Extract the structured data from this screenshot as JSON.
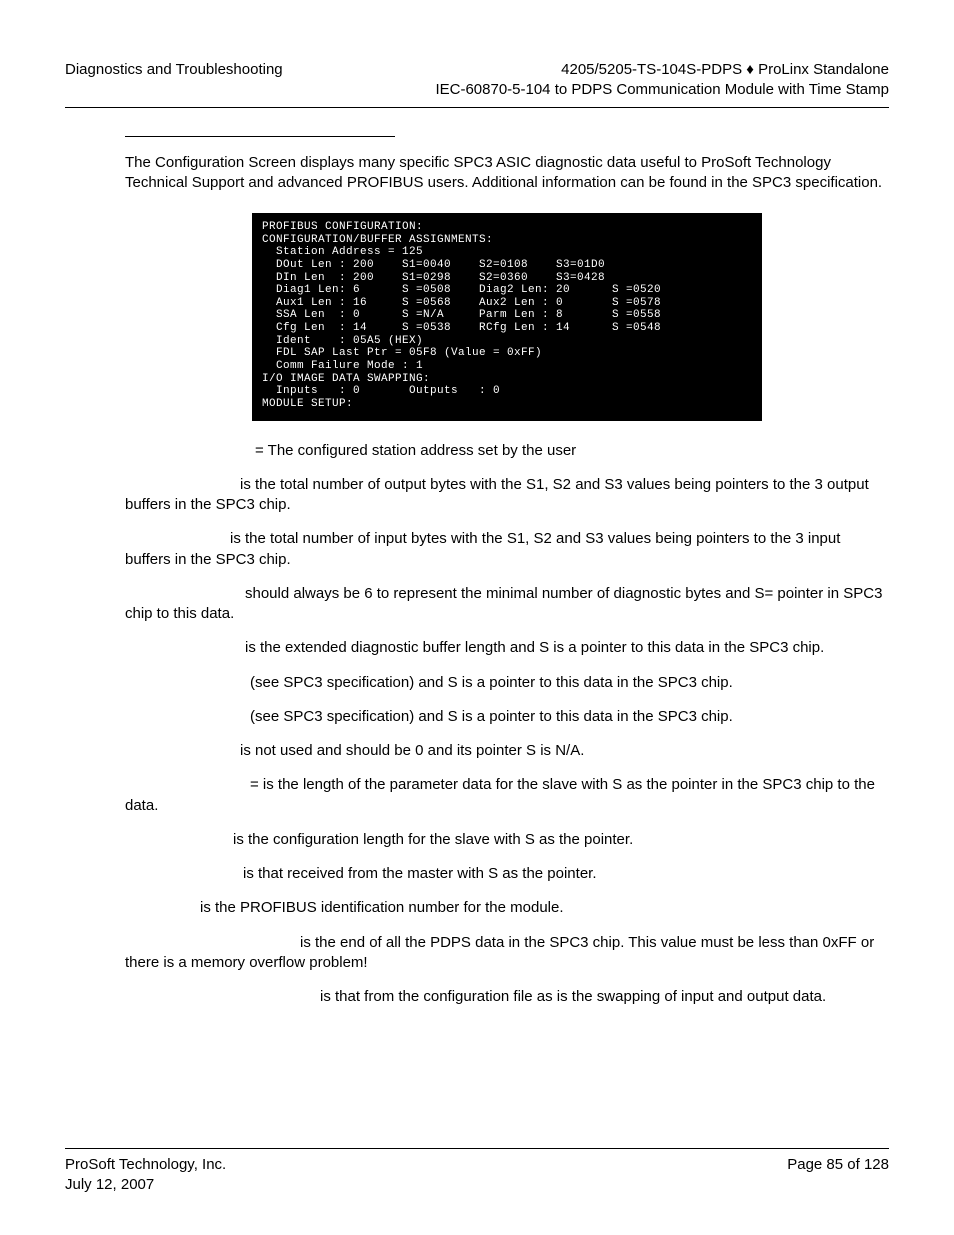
{
  "header": {
    "left": "Diagnostics and Troubleshooting",
    "right1": "4205/5205-TS-104S-PDPS ♦ ProLinx Standalone",
    "right2": "IEC-60870-5-104 to PDPS Communication Module with Time Stamp"
  },
  "intro": "The Configuration Screen displays many specific SPC3 ASIC diagnostic data useful to ProSoft Technology Technical Support and advanced PROFIBUS users. Additional information can be found in the SPC3 specification.",
  "terminal": "PROFIBUS CONFIGURATION:\nCONFIGURATION/BUFFER ASSIGNMENTS:\n  Station Address = 125\n  DOut Len : 200    S1=0040    S2=0108    S3=01D0\n  DIn Len  : 200    S1=0298    S2=0360    S3=0428\n  Diag1 Len: 6      S =0508    Diag2 Len: 20      S =0520\n  Aux1 Len : 16     S =0568    Aux2 Len : 0       S =0578\n  SSA Len  : 0      S =N/A     Parm Len : 8       S =0558\n  Cfg Len  : 14     S =0538    RCfg Len : 14      S =0548\n  Ident    : 05A5 (HEX)\n  FDL SAP Last Ptr = 05F8 (Value = 0xFF)\n  Comm Failure Mode : 1\nI/O IMAGE DATA SWAPPING:\n  Inputs   : 0       Outputs   : 0\nMODULE SETUP:",
  "defs": {
    "station_address": " = The configured station address set by the user",
    "dout_len": " is the total number of output bytes with the S1, S2 and S3 values being pointers to the 3 output buffers in the SPC3 chip.",
    "din_len": " is the total number of input bytes with the S1, S2 and S3 values being pointers to the 3 input buffers in the SPC3 chip.",
    "diag1_len": " should always be 6 to represent the minimal number of diagnostic bytes and S= pointer in SPC3 chip to this data.",
    "diag2_len": " is the extended diagnostic buffer length and S is a pointer to this data in the SPC3 chip.",
    "aux1_len": " (see SPC3 specification) and S is a pointer to this data in the SPC3 chip.",
    "aux2_len": " (see SPC3 specification) and S is a pointer to this data in the SPC3 chip.",
    "ssa_len": " is not used and should be 0 and its pointer S is N/A.",
    "parm_len": " = is the length of the parameter data for the slave with S as the pointer in the SPC3 chip to the data.",
    "cfg_len": " is the configuration length for the slave with S as the pointer.",
    "rcfg_len": " is that received from the master with S as the pointer.",
    "ident": " is the PROFIBUS identification number for the module.",
    "fdl_sap": " is the end of all the PDPS data in the SPC3 chip.  This value must be less than 0xFF or there is a memory overflow problem!",
    "comm_failure": " is that from the configuration file as is the swapping of input and output data."
  },
  "indents": {
    "station_address": "130px",
    "dout_len": "115px",
    "din_len": "105px",
    "diag1_len": "120px",
    "diag2_len": "120px",
    "aux1_len": "125px",
    "aux2_len": "125px",
    "ssa_len": "115px",
    "parm_len": "125px",
    "cfg_len": "108px",
    "rcfg_len": "118px",
    "ident": "75px",
    "fdl_sap": "175px",
    "comm_failure": "195px"
  },
  "footer": {
    "left1": "ProSoft Technology, Inc.",
    "left2": "July 12, 2007",
    "right": "Page 85 of 128"
  }
}
